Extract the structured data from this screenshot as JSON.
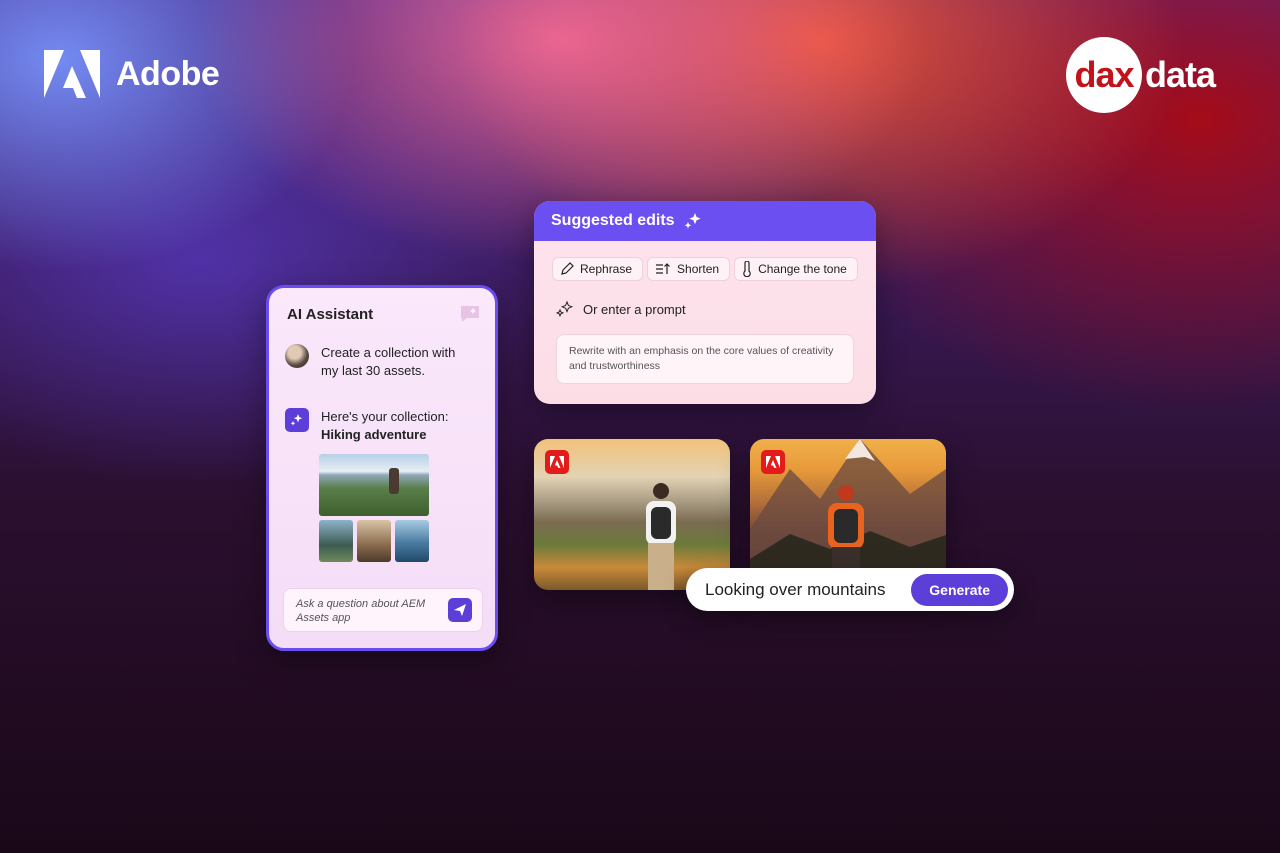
{
  "brand": {
    "left_logo": "Adobe",
    "right_logo_circle": "dax",
    "right_logo_word": "data"
  },
  "assistant": {
    "title": "AI Assistant",
    "user_message": "Create a collection with my last 30 assets.",
    "ai_message_intro": "Here's your collection:",
    "ai_message_collection": "Hiking adventure",
    "input_placeholder": "Ask a question about AEM Assets app"
  },
  "suggested_edits": {
    "title": "Suggested edits",
    "chips": [
      "Rephrase",
      "Shorten",
      "Change the tone"
    ],
    "prompt_label": "Or enter a prompt",
    "prompt_text": "Rewrite with an emphasis on the core values of creativity and trustworthiness"
  },
  "generate": {
    "prompt": "Looking over mountains",
    "button": "Generate"
  },
  "colors": {
    "accent": "#6c4ff0",
    "adobe_red": "#e21b1b",
    "dax_red": "#c4121a"
  },
  "icons": [
    "adobe-logo-icon",
    "chat-sparkle-icon",
    "sparkle-icon",
    "send-icon",
    "pen-icon",
    "shorten-icon",
    "thermometer-icon"
  ]
}
